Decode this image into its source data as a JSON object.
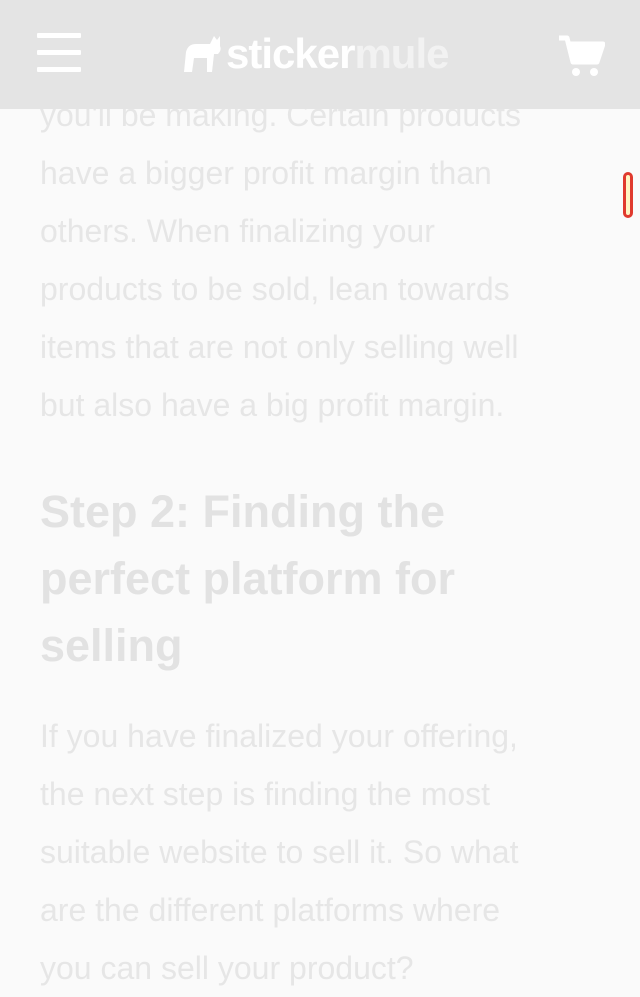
{
  "header": {
    "logo_part1": "sticker",
    "logo_part2": "mule",
    "menu_icon": "hamburger-menu-icon",
    "cart_icon": "shopping-cart-icon"
  },
  "article": {
    "para1_line1": "you'll be making. Certain products",
    "para1_line2": "have a bigger profit margin than",
    "para1_line3": "others. When finalizing your",
    "para1_line4": "products to be sold, lean towards",
    "para1_line5": "items that are not only selling well",
    "para1_line6": "but also have a big profit margin.",
    "heading_line1": "Step 2: Finding the",
    "heading_line2": "perfect platform for",
    "heading_line3": "selling",
    "para2_line1": "If you have finalized your offering,",
    "para2_line2": "the next step is finding the most",
    "para2_line3": "suitable website to sell it. So what",
    "para2_line4": "are the different platforms where",
    "para2_line5": "you can sell your product?"
  },
  "colors": {
    "header_bg": "#e4e4e4",
    "text": "#e6e6e6",
    "scroll_border": "#e03a2e"
  }
}
